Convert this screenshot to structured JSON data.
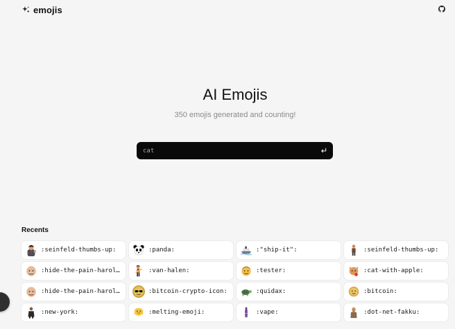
{
  "header": {
    "brand_label": "emojis",
    "brand_icon": "sparkles-icon",
    "github_icon": "github-icon"
  },
  "hero": {
    "title": "AI Emojis",
    "subtitle": "350 emojis generated and counting!"
  },
  "search": {
    "value": "cat",
    "submit_icon": "enter-key-icon"
  },
  "recents": {
    "title": "Recents",
    "items": [
      {
        "label": ":seinfeld-thumbs-up:",
        "icon": "man-in-suit-thumbs-up-icon"
      },
      {
        "label": ":panda:",
        "icon": "panda-icon"
      },
      {
        "label": ":\"ship-it\":",
        "icon": "ship-icon"
      },
      {
        "label": ":seinfeld-thumbs-up:",
        "icon": "man-standing-icon"
      },
      {
        "label": ":hide-the-pain-harold:",
        "icon": "old-man-face-icon"
      },
      {
        "label": ":van-halen:",
        "icon": "guitarist-icon"
      },
      {
        "label": ":tester:",
        "icon": "smiling-face-icon"
      },
      {
        "label": ":cat-with-apple:",
        "icon": "cat-icon"
      },
      {
        "label": ":hide-the-pain-harold:",
        "icon": "old-man-face-icon"
      },
      {
        "label": ":bitcoin-crypto-icon:",
        "icon": "sunglasses-coin-icon"
      },
      {
        "label": ":quidax:",
        "icon": "turtle-icon"
      },
      {
        "label": ":bitcoin:",
        "icon": "coin-face-icon"
      },
      {
        "label": ":new-york:",
        "icon": "man-in-coat-icon"
      },
      {
        "label": ":melting-emoji:",
        "icon": "melting-face-icon"
      },
      {
        "label": ":vape:",
        "icon": "vape-pen-icon"
      },
      {
        "label": ":dot-net-fakku:",
        "icon": "bearded-man-icon"
      }
    ]
  }
}
